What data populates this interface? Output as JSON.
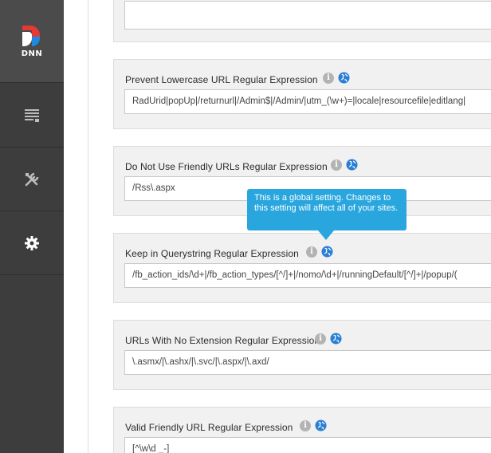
{
  "brand": {
    "logo_text": "DNN"
  },
  "sidebar": {
    "items": [
      {
        "name": "content",
        "icon": "page-icon"
      },
      {
        "name": "tools",
        "icon": "tools-icon"
      },
      {
        "name": "settings",
        "icon": "gear-icon"
      }
    ]
  },
  "settings": [
    {
      "label": "Prevent Lowercase URL Regular Expression",
      "value": "RadUrid|popUp|/returnurl|/Admin$|/Admin/|utm_(\\w+)=|locale|resourcefile|editlang|"
    },
    {
      "label": "Do Not Use Friendly URLs Regular Expression",
      "value": "/Rss\\.aspx"
    },
    {
      "label": "Keep in Querystring Regular Expression",
      "value": "/fb_action_ids/\\d+|/fb_action_types/[^/]+|/nomo/\\d+|/runningDefault/[^/]+|/popup/("
    },
    {
      "label": "URLs With No Extension Regular Expression",
      "value": "\\.asmx/|\\.ashx/|\\.svc/|\\.aspx/|\\.axd/"
    },
    {
      "label": "Valid Friendly URL Regular Expression",
      "value": "[^\\w\\d _-]"
    }
  ],
  "tooltip": {
    "text": "This is a global setting. Changes to this setting will affect all of your sites."
  },
  "colors": {
    "sidebar": "#3d3d3d",
    "accent": "#2aa6df",
    "logo_red": "#e53935",
    "logo_blue": "#1e88e5"
  }
}
